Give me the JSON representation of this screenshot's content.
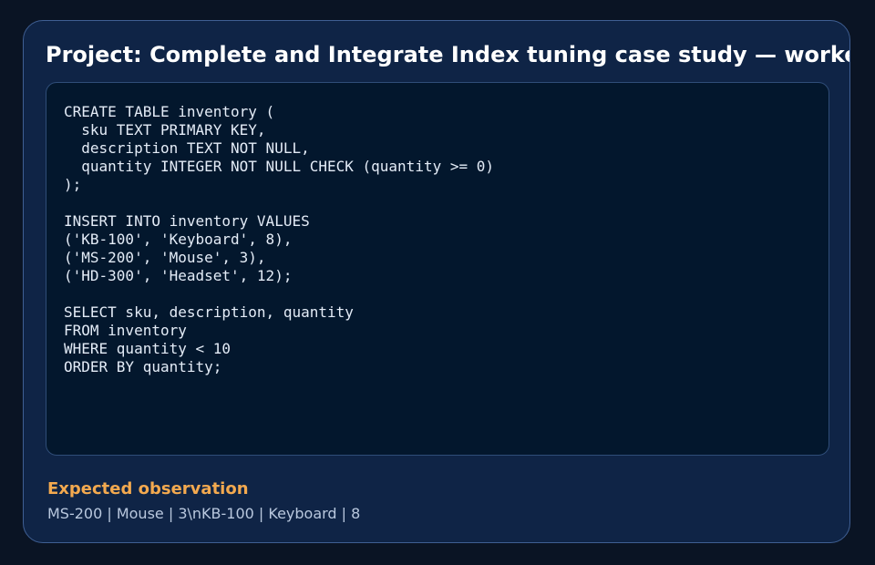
{
  "card": {
    "title": "Project: Complete and Integrate Index tuning case study — worked example"
  },
  "code_panel": {
    "code": "CREATE TABLE inventory (\n  sku TEXT PRIMARY KEY,\n  description TEXT NOT NULL,\n  quantity INTEGER NOT NULL CHECK (quantity >= 0)\n);\n\nINSERT INTO inventory VALUES\n('KB-100', 'Keyboard', 8),\n('MS-200', 'Mouse', 3),\n('HD-300', 'Headset', 12);\n\nSELECT sku, description, quantity\nFROM inventory\nWHERE quantity < 10\nORDER BY quantity;"
  },
  "observation": {
    "heading": "Expected observation",
    "value": "MS-200 | Mouse | 3\\nKB-100 | Keyboard | 8"
  },
  "colors": {
    "background": "#0a1424",
    "card": "#0f2446",
    "card_border": "#3f5f93",
    "code_background": "#03172d",
    "title": "#ffffff",
    "accent": "#f3a94f",
    "observation_text": "#b9c8de"
  }
}
